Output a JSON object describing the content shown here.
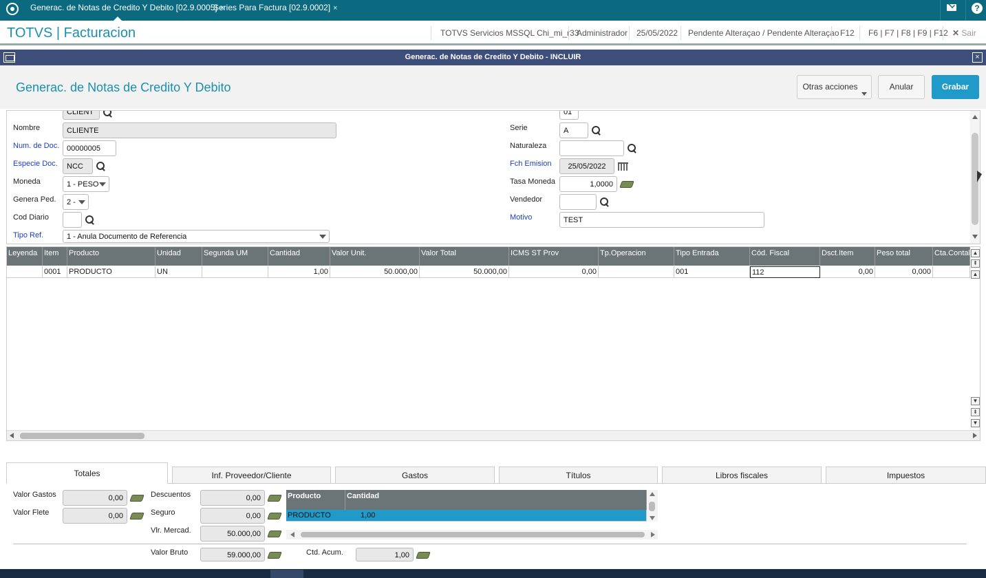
{
  "topbar": {
    "tabs": [
      {
        "label": "Generac. de Notas de Credito Y Debito [02.9.0005]",
        "close": "×"
      },
      {
        "label": "Series Para Factura [02.9.0002]",
        "close": "×"
      }
    ],
    "mail_icon": "mail-icon",
    "help_icon": "help-icon"
  },
  "header": {
    "app_title": "TOTVS | Facturacion",
    "items": [
      "TOTVS Servicios MSSQL Chi_mi_r33",
      "Administrador",
      "25/05/2022",
      "Pendente Alteraçao / Pendente Alteraçao",
      "F12",
      "F6 | F7 | F8 | F9 | F12"
    ],
    "exit_label": "Sair"
  },
  "dialog": {
    "title": "Generac. de Notas de Credito Y Debito - INCLUIR",
    "close": "×"
  },
  "form": {
    "title": "Generac. de Notas de Credito Y Debito",
    "buttons": {
      "other": "Otras acciones",
      "cancel": "Anular",
      "save": "Grabar"
    },
    "fields": {
      "cliente_partial": "CLIENT",
      "tienda_partial": "01",
      "nombre_label": "Nombre",
      "nombre": "CLIENTE",
      "num_doc_label": "Num. de Doc.",
      "num_doc": "00000005",
      "especie_label": "Especie Doc.",
      "especie": "NCC",
      "moneda_label": "Moneda",
      "moneda": "1 - PESO",
      "genera_label": "Genera Ped.",
      "genera": "2 -",
      "cod_diario_label": "Cod Diario",
      "cod_diario": "",
      "tipo_ref_label": "Tipo Ref.",
      "tipo_ref": "1 - Anula Documento de Referencia",
      "serie_label": "Serie",
      "serie": "A",
      "naturaleza_label": "Naturaleza",
      "naturaleza": "",
      "fch_emision_label": "Fch Emision",
      "fch_emision": "25/05/2022",
      "tasa_label": "Tasa Moneda",
      "tasa": "1,0000",
      "vendedor_label": "Vendedor",
      "vendedor": "",
      "motivo_label": "Motivo",
      "motivo": "TEST"
    }
  },
  "grid": {
    "columns": [
      "Leyenda",
      "Item",
      "Producto",
      "Unidad",
      "Segunda UM",
      "Cantidad",
      "Valor Unit.",
      "Valor Total",
      "ICMS ST Prov",
      "Tp.Operacion",
      "Tipo Entrada",
      "Cód. Fiscal",
      "Dsct.Item",
      "Peso total",
      "Cta.Contab"
    ],
    "rows": [
      [
        "",
        "0001",
        "PRODUCTO",
        "UN",
        "",
        "1,00",
        "50.000,00",
        "50.000,00",
        "0,00",
        "",
        "001",
        "112",
        "0,00",
        "0,000",
        ""
      ]
    ]
  },
  "tabs": [
    "Totales",
    "Inf. Proveedor/Cliente",
    "Gastos",
    "Títulos",
    "Libros fiscales",
    "Impuestos"
  ],
  "totals": {
    "valor_gastos_label": "Valor Gastos",
    "valor_gastos": "0,00",
    "valor_flete_label": "Valor Flete",
    "valor_flete": "0,00",
    "descuentos_label": "Descuentos",
    "descuentos": "0,00",
    "seguro_label": "Seguro",
    "seguro": "0,00",
    "vlr_mercad_label": "Vlr. Mercad.",
    "vlr_mercad": "50.000,00",
    "valor_bruto_label": "Valor Bruto",
    "valor_bruto": "59.000,00",
    "ctd_acum_label": "Ctd. Acum.",
    "ctd_acum": "1,00",
    "mini_columns": [
      "Producto",
      "Cantidad"
    ],
    "mini_rows": [
      [
        "PRODUCTO",
        "1,00"
      ]
    ]
  },
  "colors": {
    "topbar": "#0c6a80",
    "accent": "#1a8fb0",
    "dialog": "#3e4e7a",
    "primary_button": "#1f9ac9"
  }
}
